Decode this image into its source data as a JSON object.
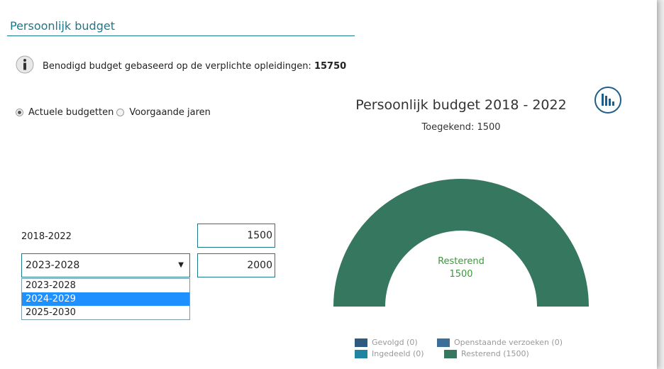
{
  "section": {
    "title": "Persoonlijk budget"
  },
  "info": {
    "text": "Benodigd budget gebaseerd op de verplichte opleidingen: ",
    "value": "15750"
  },
  "radio": {
    "options": [
      {
        "label": "Actuele budgetten",
        "checked": true
      },
      {
        "label": "Voorgaande jaren",
        "checked": false
      }
    ]
  },
  "budgets": {
    "period1": {
      "label": "2018-2022",
      "amount": "1500"
    },
    "period2": {
      "selected": "2023-2028",
      "amount": "2000"
    },
    "dropdown_options": [
      "2023-2028",
      "2024-2029",
      "2025-2030"
    ],
    "highlighted_option": "2024-2029"
  },
  "chart": {
    "title": "Persoonlijk budget 2018 - 2022",
    "subtitle": "Toegekend: 1500",
    "center_label": "Resterend",
    "center_value": "1500",
    "toggle_icon": "bar-chart-icon"
  },
  "chart_data": {
    "type": "pie",
    "title": "Persoonlijk budget 2018 - 2022",
    "subtitle": "Toegekend: 1500",
    "series": [
      {
        "name": "Gevolgd",
        "value": 0,
        "color": "#2e5a80"
      },
      {
        "name": "Openstaande verzoeken",
        "value": 0,
        "color": "#3b6e98"
      },
      {
        "name": "Ingedeeld",
        "value": 0,
        "color": "#1f85a0"
      },
      {
        "name": "Resterend",
        "value": 1500,
        "color": "#367760"
      }
    ],
    "legend": [
      "Gevolgd (0)",
      "Openstaande verzoeken (0)",
      "Ingedeeld (0)",
      "Resterend (1500)"
    ]
  },
  "colors": {
    "accent": "#1a7a8c",
    "highlight": "#1e90ff",
    "center_text": "#3a9a3a"
  }
}
